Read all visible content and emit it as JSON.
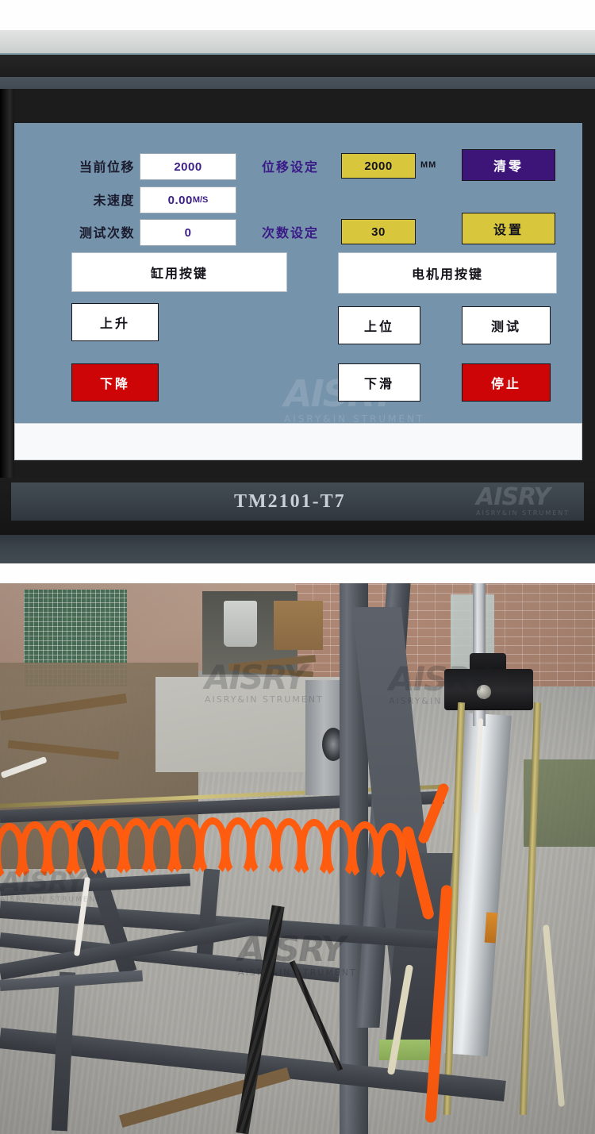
{
  "device": {
    "model_label": "TM2101-T7",
    "brand_watermark_main": "AISRY",
    "brand_watermark_sub": "AISRY&IN STRUMENT"
  },
  "hmi": {
    "readouts": [
      {
        "label": "当前位移",
        "value": "2000",
        "unit": ""
      },
      {
        "label": "未速度",
        "value": "0.00",
        "unit": "M/S"
      },
      {
        "label": "测试次数",
        "value": "0",
        "unit": ""
      }
    ],
    "settings": [
      {
        "label": "位移设定",
        "value": "2000",
        "unit": "MM"
      },
      {
        "label": "次数设定",
        "value": "30",
        "unit": ""
      }
    ],
    "action_buttons": {
      "clear_zero": "清零",
      "set": "设置"
    },
    "groups": [
      {
        "header": "缸用按键",
        "buttons": [
          {
            "label": "上升",
            "style": "white"
          },
          {
            "label": "下降",
            "style": "red"
          }
        ]
      },
      {
        "header": "电机用按键",
        "buttons": [
          {
            "label": "上位",
            "style": "white"
          },
          {
            "label": "下滑",
            "style": "white"
          }
        ]
      }
    ],
    "test_buttons": [
      {
        "label": "测试",
        "style": "white"
      },
      {
        "label": "停止",
        "style": "red"
      }
    ],
    "status_bar_text": ""
  },
  "colors": {
    "panel_bg": "#7593ab",
    "readout_bg": "#ffffff",
    "readout_text": "#3c1f86",
    "setting_bg": "#d8c63d",
    "accent_purple": "#3d1578",
    "accent_red": "#ce0506",
    "accent_yellow": "#d8c63d",
    "label_dark": "#1b1b2e",
    "label_purple": "#3a1a86"
  }
}
